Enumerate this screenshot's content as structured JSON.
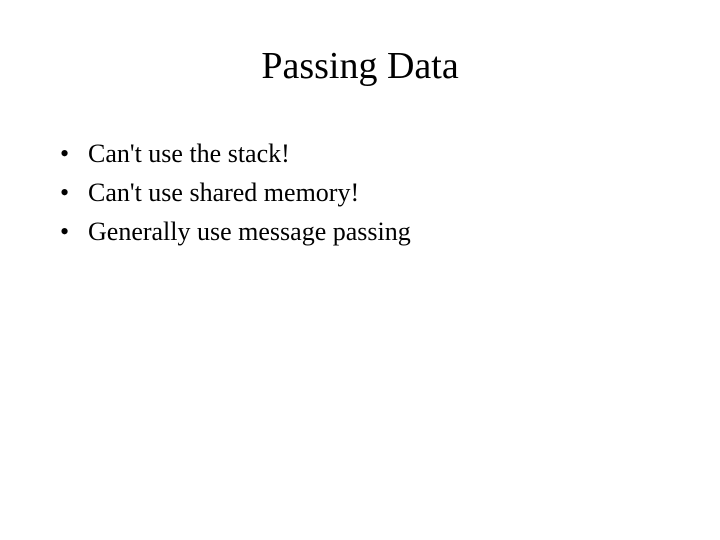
{
  "slide": {
    "title": "Passing Data",
    "bullets": [
      "Can't use the stack!",
      "Can't use shared memory!",
      "Generally use message passing"
    ]
  }
}
